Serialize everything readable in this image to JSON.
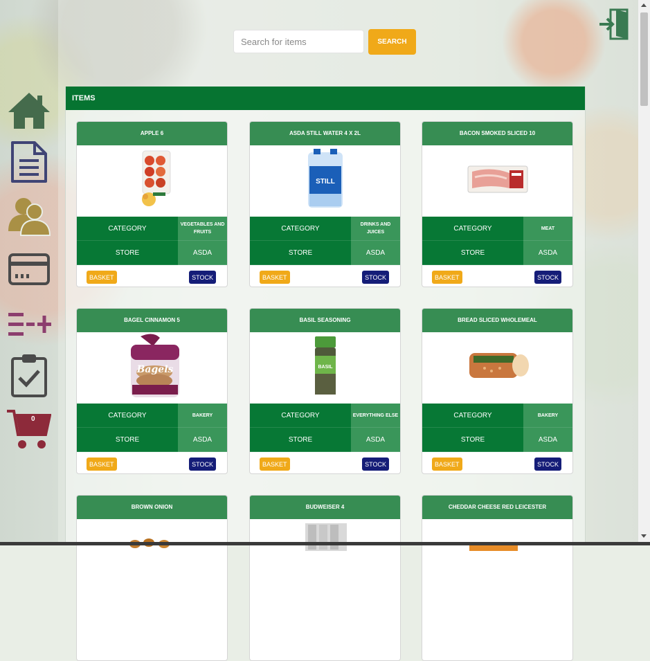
{
  "search": {
    "placeholder": "Search for items",
    "button_label": "SEARCH"
  },
  "panel": {
    "title": "ITEMS"
  },
  "cart": {
    "count": "0"
  },
  "labels": {
    "category": "CATEGORY",
    "store": "STORE",
    "basket": "BASKET",
    "stock": "STOCK"
  },
  "colors": {
    "primary_green": "#067431",
    "card_header_green": "#378d53",
    "accent_orange": "#f0a919",
    "stock_navy": "#151d78",
    "sidebar_house": "#456b4c",
    "sidebar_doc": "#3f4475",
    "sidebar_user": "#a99045",
    "sidebar_card": "#4a4a4a",
    "sidebar_list": "#8c3e6e",
    "sidebar_clipboard": "#4a4a4a",
    "sidebar_cart": "#8d2a3a"
  },
  "items": [
    {
      "name": "APPLE 6",
      "category": "VEGETABLES AND FRUITS",
      "store": "ASDA",
      "image": "apple-pack"
    },
    {
      "name": "ASDA STILL WATER 4 X 2L",
      "category": "DRINKS AND JUICES",
      "store": "ASDA",
      "image": "water-pack"
    },
    {
      "name": "BACON SMOKED SLICED 10",
      "category": "MEAT",
      "store": "ASDA",
      "image": "bacon-pack"
    },
    {
      "name": "BAGEL CINNAMON 5",
      "category": "BAKERY",
      "store": "ASDA",
      "image": "bagel-bag"
    },
    {
      "name": "BASIL SEASONING",
      "category": "EVERYTHING ELSE",
      "store": "ASDA",
      "image": "basil-jar"
    },
    {
      "name": "BREAD SLICED WHOLEMEAL",
      "category": "BAKERY",
      "store": "ASDA",
      "image": "bread-loaf"
    },
    {
      "name": "BROWN ONION",
      "image": "onions"
    },
    {
      "name": "BUDWEISER 4",
      "image": "beer-cans"
    },
    {
      "name": "CHEDDAR CHEESE RED LEICESTER",
      "image": "cheese"
    }
  ]
}
